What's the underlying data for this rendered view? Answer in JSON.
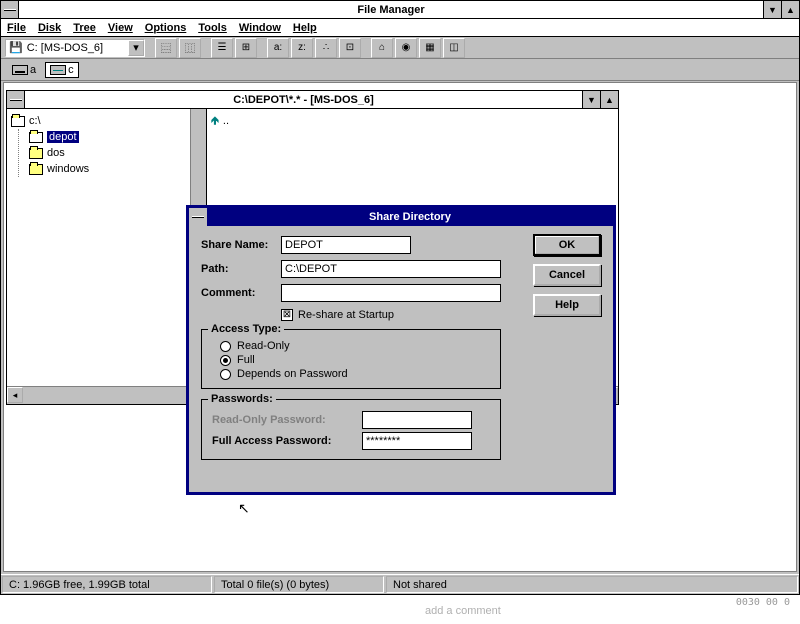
{
  "main": {
    "title": "File Manager",
    "menus": [
      "File",
      "Disk",
      "Tree",
      "View",
      "Options",
      "Tools",
      "Window",
      "Help"
    ],
    "drive_combo": "C: [MS-DOS_6]",
    "drives": [
      {
        "letter": "a",
        "type": "fdd",
        "selected": false
      },
      {
        "letter": "c",
        "type": "hdd",
        "selected": true
      }
    ]
  },
  "child": {
    "title": "C:\\DEPOT\\*.* - [MS-DOS_6]",
    "tree": {
      "root": "c:\\",
      "items": [
        "depot",
        "dos",
        "windows"
      ],
      "selected": "depot"
    },
    "files": {
      "up": ".."
    }
  },
  "status": {
    "pane1": "C: 1.96GB free,  1.99GB total",
    "pane2": "Total 0 file(s) (0 bytes)",
    "pane3": "Not shared"
  },
  "dialog": {
    "title": "Share Directory",
    "share_name_label": "Share Name:",
    "share_name": "DEPOT",
    "path_label": "Path:",
    "path": "C:\\DEPOT",
    "comment_label": "Comment:",
    "comment": "",
    "reshare": "Re-share at Startup",
    "reshare_checked": true,
    "access_legend": "Access Type:",
    "access": {
      "readonly": "Read-Only",
      "full": "Full",
      "depends": "Depends on Password",
      "selected": "full"
    },
    "pw_legend": "Passwords:",
    "ro_pw_label": "Read-Only Password:",
    "full_pw_label": "Full Access Password:",
    "full_pw": "********",
    "ok": "OK",
    "cancel": "Cancel",
    "help": "Help"
  },
  "strip": {
    "comment": "add a comment",
    "nums": "0030   00 0"
  }
}
